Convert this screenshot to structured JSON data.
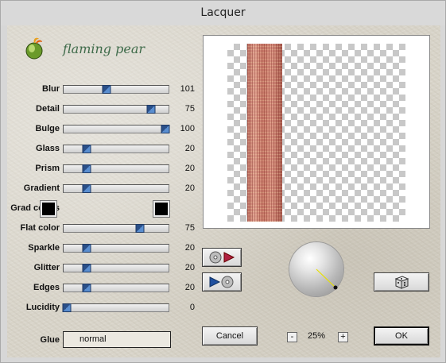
{
  "window": {
    "title": "Lacquer"
  },
  "brand": {
    "name": "flaming pear"
  },
  "controls": [
    {
      "label": "Blur",
      "value": "101",
      "level": 0.41
    },
    {
      "label": "Detail",
      "value": "75",
      "level": 0.83
    },
    {
      "label": "Bulge",
      "value": "100",
      "level": 0.97
    },
    {
      "label": "Glass",
      "value": "20",
      "level": 0.22
    },
    {
      "label": "Prism",
      "value": "20",
      "level": 0.22
    },
    {
      "label": "Gradient",
      "value": "20",
      "level": 0.22
    },
    {
      "label": "Flat color",
      "value": "75",
      "level": 0.73
    },
    {
      "label": "Sparkle",
      "value": "20",
      "level": 0.22
    },
    {
      "label": "Glitter",
      "value": "20",
      "level": 0.22
    },
    {
      "label": "Edges",
      "value": "20",
      "level": 0.22
    },
    {
      "label": "Lucidity",
      "value": "0",
      "level": 0.03
    }
  ],
  "grad_colors": {
    "label": "Grad colors",
    "color_a": "#000000",
    "color_b": "#000000"
  },
  "glue": {
    "label": "Glue",
    "value": "normal"
  },
  "buttons": {
    "cancel": "Cancel",
    "ok": "OK"
  },
  "zoom": {
    "value": "25%",
    "minus": "-",
    "plus": "+"
  },
  "icons": {
    "logo": "flaming-pear-logo-icon",
    "load_preset": "load-preset-icon",
    "save_preset": "save-preset-icon",
    "randomize": "dice-icon",
    "light_direction": "light-sphere-icon"
  }
}
